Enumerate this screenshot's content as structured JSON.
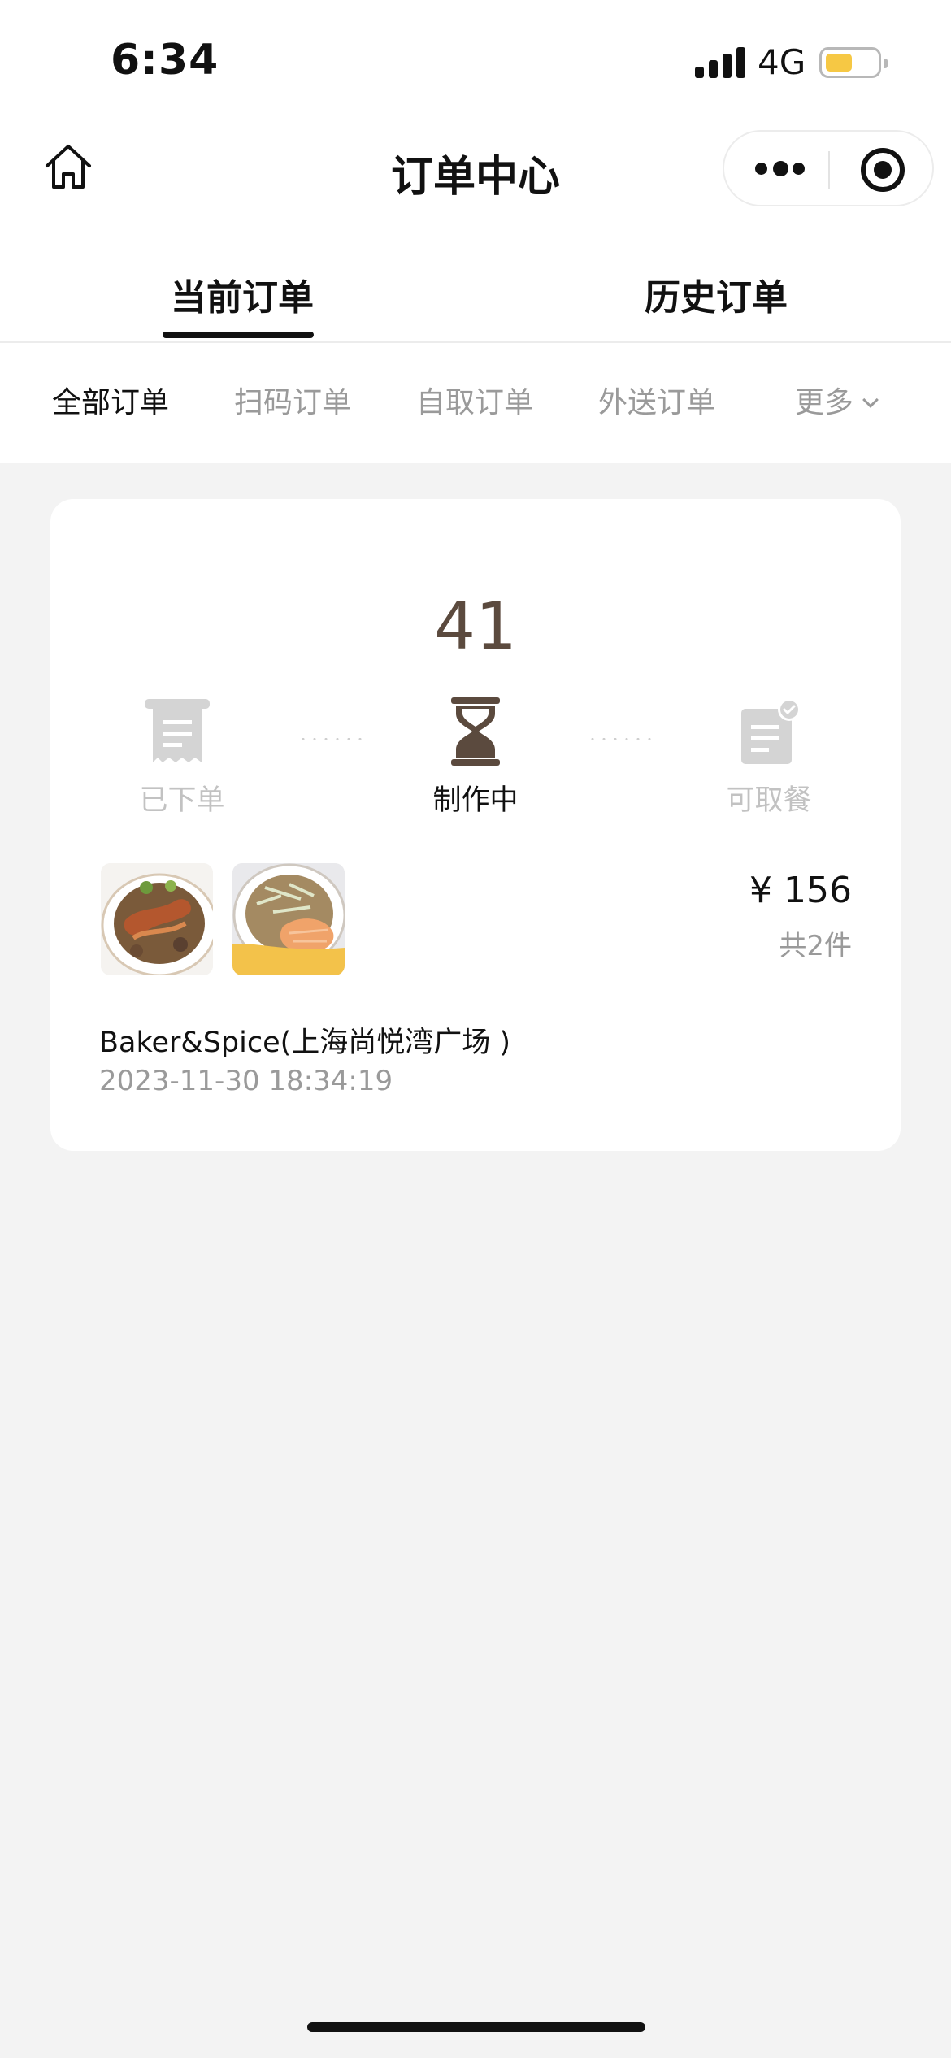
{
  "status_bar": {
    "time": "6:34",
    "network": "4G"
  },
  "nav": {
    "title": "订单中心"
  },
  "tabs": {
    "current": "当前订单",
    "history": "历史订单"
  },
  "filters": [
    {
      "label": "全部订单",
      "active": true
    },
    {
      "label": "扫码订单",
      "active": false
    },
    {
      "label": "自取订单",
      "active": false
    },
    {
      "label": "外送订单",
      "active": false
    },
    {
      "label": "更多",
      "active": false
    }
  ],
  "order": {
    "pickup_number": "41",
    "steps": [
      {
        "label": "已下单",
        "active": false,
        "icon": "receipt-icon"
      },
      {
        "label": "制作中",
        "active": true,
        "icon": "hourglass-icon"
      },
      {
        "label": "可取餐",
        "active": false,
        "icon": "ready-document-icon"
      }
    ],
    "price": "¥ 156",
    "item_count": "共2件",
    "store": "Baker&Spice(上海尚悦湾广场 )",
    "datetime": "2023-11-30 18:34:19"
  },
  "colors": {
    "accent_brown": "#5b4a3e",
    "inactive": "#c2c2c2",
    "battery": "#f6c844",
    "background": "#f3f3f3"
  }
}
